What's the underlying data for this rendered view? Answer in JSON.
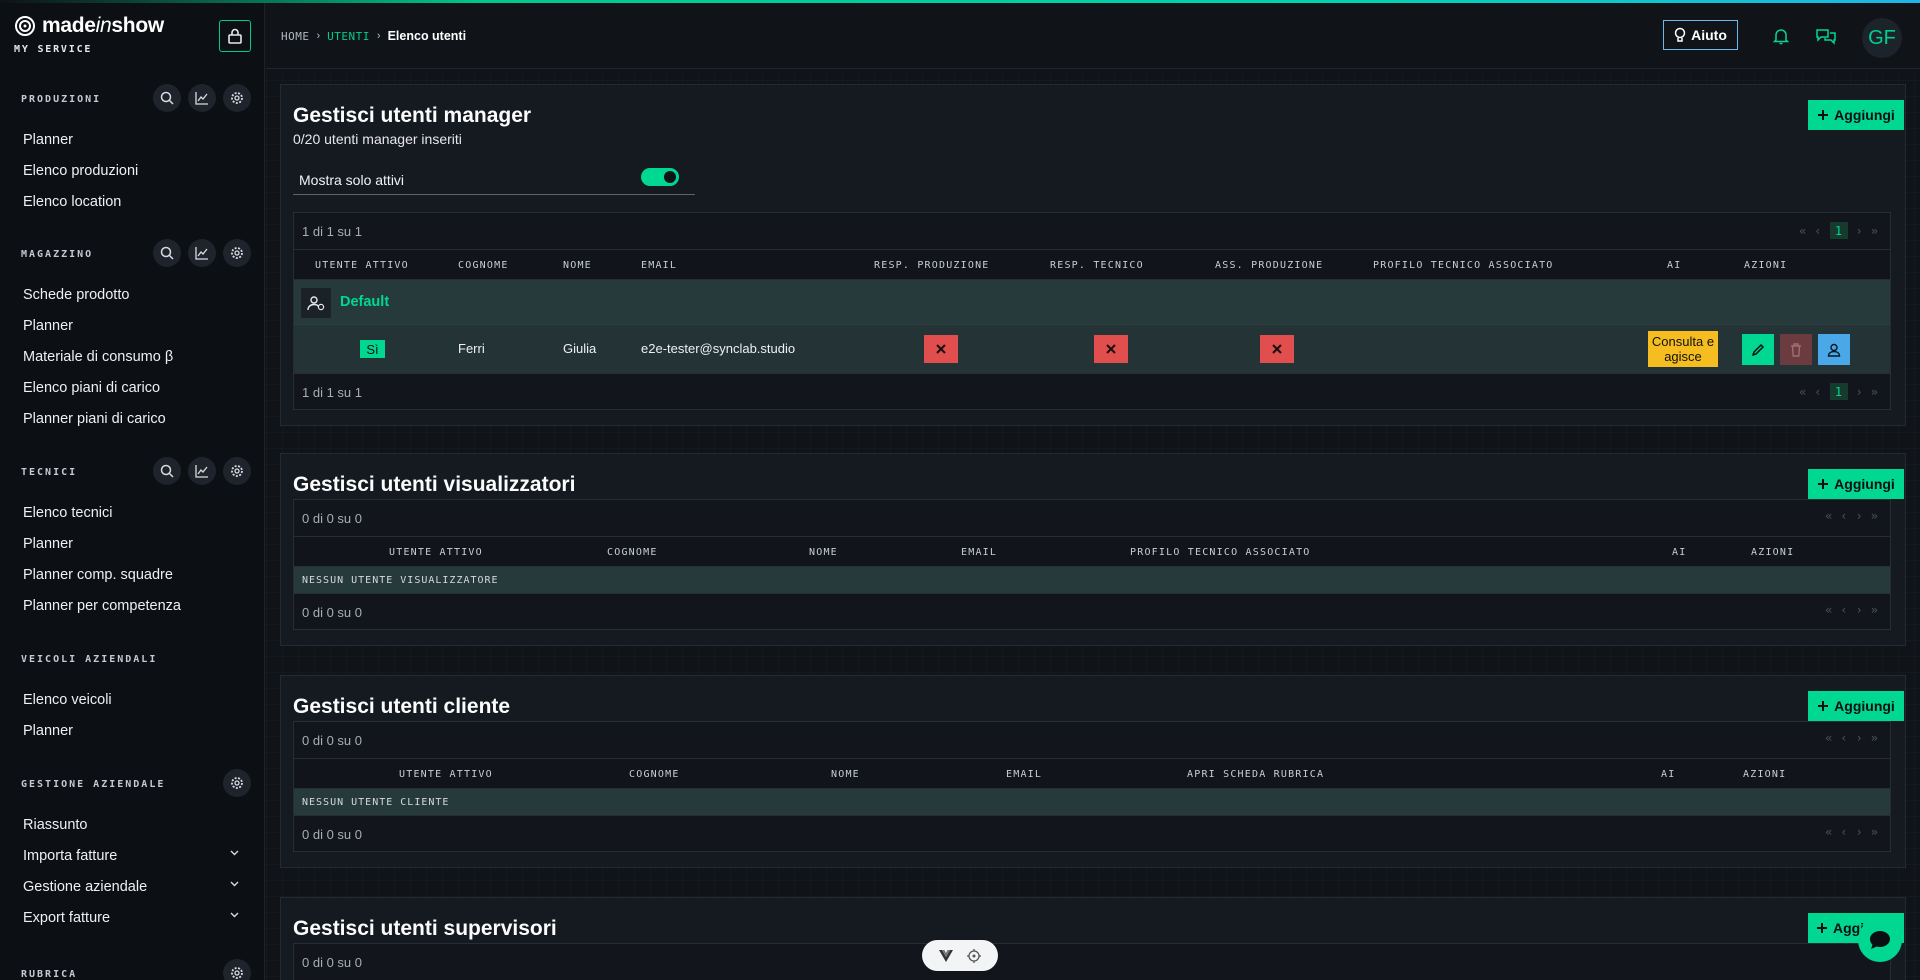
{
  "brand": {
    "name_main": "made",
    "name_italic": "in",
    "name_end": "show",
    "subtitle": "MY SERVICE"
  },
  "sidebar": {
    "sections": [
      {
        "title": "PRODUZIONI",
        "items": [
          "Planner",
          "Elenco produzioni",
          "Elenco location"
        ]
      },
      {
        "title": "MAGAZZINO",
        "items": [
          "Schede prodotto",
          "Planner",
          "Materiale di consumo β",
          "Elenco piani di carico",
          "Planner piani di carico"
        ]
      },
      {
        "title": "TECNICI",
        "items": [
          "Elenco tecnici",
          "Planner",
          "Planner comp. squadre",
          "Planner per competenza"
        ]
      },
      {
        "title": "VEICOLI AZIENDALI",
        "items": [
          "Elenco veicoli",
          "Planner"
        ]
      },
      {
        "title": "GESTIONE AZIENDALE",
        "items": [
          "Riassunto",
          "Importa fatture",
          "Gestione aziendale",
          "Export fatture"
        ]
      },
      {
        "title": "RUBRICA",
        "items": []
      }
    ]
  },
  "breadcrumb": {
    "home": "HOME",
    "users": "UTENTI",
    "current": "Elenco utenti"
  },
  "header": {
    "help_label": "Aiuto",
    "avatar_initials": "GF"
  },
  "common": {
    "add_label": "Aggiungi",
    "add_label_partial": "Aggiu",
    "page_one": "1"
  },
  "manager": {
    "title": "Gestisci utenti manager",
    "subtitle": "0/20 utenti manager inseriti",
    "toggle_label": "Mostra solo attivi",
    "pagination": "1 di 1 su 1",
    "columns": [
      "UTENTE ATTIVO",
      "COGNOME",
      "NOME",
      "EMAIL",
      "RESP. PRODUZIONE",
      "RESP. TECNICO",
      "ASS. PRODUZIONE",
      "PROFILO TECNICO ASSOCIATO",
      "AI",
      "AZIONI"
    ],
    "group_label": "Default",
    "row": {
      "active": "Sì",
      "surname": "Ferri",
      "name": "Giulia",
      "email": "e2e-tester@synclab.studio",
      "ai": "Consulta e agisce"
    }
  },
  "viewers": {
    "title": "Gestisci utenti visualizzatori",
    "pagination": "0 di 0 su 0",
    "columns": [
      "UTENTE ATTIVO",
      "COGNOME",
      "NOME",
      "EMAIL",
      "PROFILO TECNICO ASSOCIATO",
      "AI",
      "AZIONI"
    ],
    "empty": "NESSUN UTENTE VISUALIZZATORE"
  },
  "clients": {
    "title": "Gestisci utenti cliente",
    "pagination": "0 di 0 su 0",
    "columns": [
      "UTENTE ATTIVO",
      "COGNOME",
      "NOME",
      "EMAIL",
      "APRI SCHEDA RUBRICA",
      "AI",
      "AZIONI"
    ],
    "empty": "NESSUN UTENTE CLIENTE"
  },
  "supervisors": {
    "title": "Gestisci utenti supervisori",
    "pagination": "0 di 0 su 0"
  },
  "colors": {
    "accent": "#00d891",
    "danger": "#e04e4e",
    "warning": "#f5bd1f",
    "info": "#4aa8e8"
  }
}
